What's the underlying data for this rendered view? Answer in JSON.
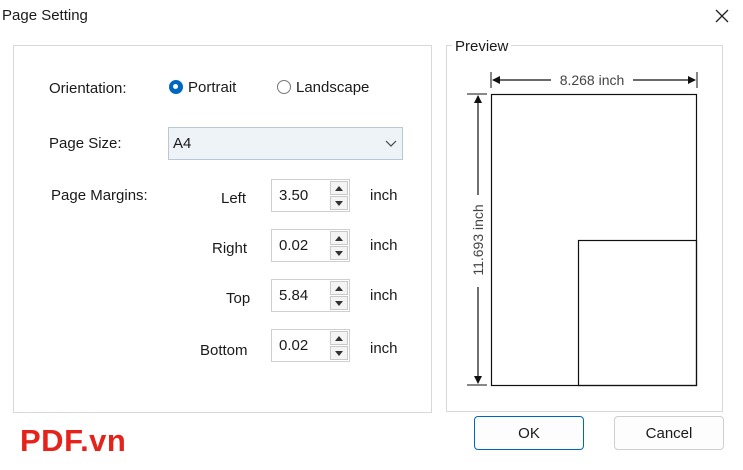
{
  "window": {
    "title": "Page Setting",
    "close_icon": "close-icon"
  },
  "orientation": {
    "label": "Orientation:",
    "options": [
      {
        "label": "Portrait",
        "selected": true
      },
      {
        "label": "Landscape",
        "selected": false
      }
    ]
  },
  "page_size": {
    "label": "Page Size:",
    "value": "A4"
  },
  "margins": {
    "label": "Page Margins:",
    "unit": "inch",
    "left": {
      "label": "Left",
      "value": "3.50"
    },
    "right": {
      "label": "Right",
      "value": "0.02"
    },
    "top": {
      "label": "Top",
      "value": "5.84"
    },
    "bottom": {
      "label": "Bottom",
      "value": "0.02"
    }
  },
  "preview": {
    "label": "Preview",
    "width_text": "8.268 inch",
    "height_text": "11.693 inch"
  },
  "buttons": {
    "ok": "OK",
    "cancel": "Cancel"
  },
  "watermark": "PDF.vn",
  "colors": {
    "accent": "#0067c0",
    "watermark": "#e5231b"
  }
}
